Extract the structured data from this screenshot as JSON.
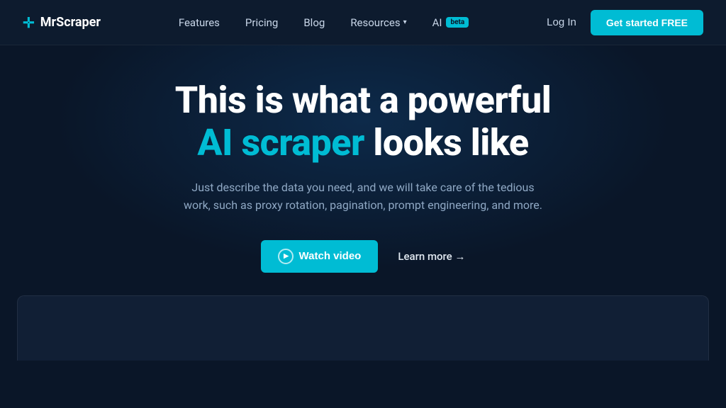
{
  "nav": {
    "logo_icon": "✛",
    "logo_text": "MrScraper",
    "links": [
      {
        "label": "Features",
        "id": "features"
      },
      {
        "label": "Pricing",
        "id": "pricing"
      },
      {
        "label": "Blog",
        "id": "blog"
      },
      {
        "label": "Resources",
        "id": "resources",
        "has_dropdown": true
      },
      {
        "label": "AI",
        "id": "ai",
        "has_badge": true,
        "badge_text": "beta"
      }
    ],
    "login_label": "Log In",
    "cta_label": "Get started FREE"
  },
  "hero": {
    "title_line1": "This is what a powerful",
    "title_highlight": "AI scraper",
    "title_line2": "looks like",
    "subtitle": "Just describe the data you need, and we will take care of the tedious work, such as proxy rotation, pagination, prompt engineering, and more.",
    "watch_video_label": "Watch video",
    "learn_more_label": "Learn more →"
  },
  "colors": {
    "accent": "#00bcd4",
    "background": "#0a1628",
    "nav_bg": "#0d1b2e",
    "preview_bg": "#111f35"
  }
}
